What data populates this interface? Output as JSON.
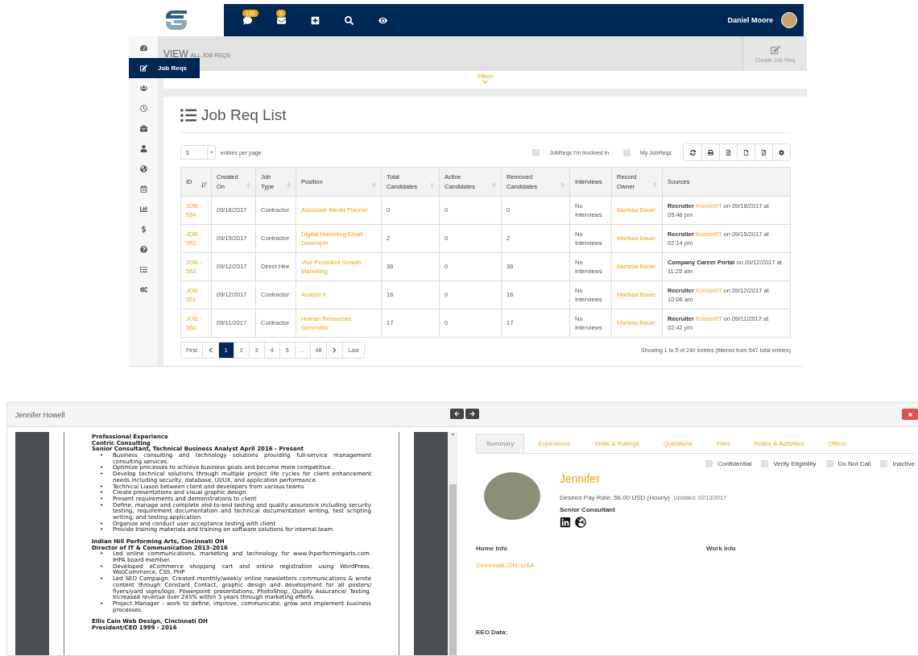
{
  "navbar": {
    "badges": [
      {
        "kind": "comments",
        "count": "131"
      },
      {
        "kind": "messages",
        "count": "8"
      },
      {
        "kind": "add"
      },
      {
        "kind": "search"
      },
      {
        "kind": "watch"
      }
    ],
    "user": "Daniel Moore"
  },
  "sidebar": {
    "items": [
      {
        "selected": false
      },
      {
        "selected": true,
        "label": "Job Reqs"
      },
      {
        "selected": false
      },
      {
        "selected": false
      },
      {
        "selected": false
      },
      {
        "selected": false
      },
      {
        "selected": false
      },
      {
        "selected": false
      },
      {
        "selected": false
      },
      {
        "selected": false
      },
      {
        "selected": false
      },
      {
        "selected": false
      },
      {
        "selected": false
      }
    ]
  },
  "header": {
    "title": "VIEW",
    "subtitle": "ALL JOB REQS",
    "action": "Create Job Req",
    "filters": "Filters"
  },
  "card": {
    "title": "Job Req List",
    "page_size": "5",
    "page_size_label": "entries per page",
    "checkboxes": [
      {
        "label": "JobReqs I'm involved in",
        "checked": false
      },
      {
        "label": "My JobReqs",
        "checked": false
      }
    ],
    "columns": [
      {
        "label": "ID",
        "sorted": true
      },
      {
        "label": "Created On",
        "sorted": false
      },
      {
        "label": "Job Type",
        "sorted": false
      },
      {
        "label": "Position",
        "sorted": false
      },
      {
        "label": "Total Candidates",
        "sorted": false
      },
      {
        "label": "Active Candidates",
        "sorted": false
      },
      {
        "label": "Removed Candidates",
        "sorted": false
      },
      {
        "label": "Interviews"
      },
      {
        "label": "Record Owner",
        "sorted": false
      },
      {
        "label": "Sources"
      }
    ],
    "rows": [
      {
        "id": "JOB - 554",
        "created": "09/18/2017",
        "type": "Contractor",
        "position": "Associate Media Planner",
        "total": "0",
        "active": "0",
        "removed": "0",
        "interviews": "No Interviews",
        "owner": "Marissa Bauer",
        "source": {
          "label": "Recruiter",
          "link": "KoncertIT",
          "rest": "on 09/18/2017 at 05:46 pm"
        }
      },
      {
        "id": "JOB - 553",
        "created": "09/15/2017",
        "type": "Contractor",
        "position": "Digital Marketing Email Developer",
        "total": "2",
        "active": "0",
        "removed": "2",
        "interviews": "No Interviews",
        "owner": "Marissa Bauer",
        "source": {
          "label": "Recruiter",
          "link": "KoncertIT",
          "rest": "on 09/15/2017 at 02:14 pm"
        }
      },
      {
        "id": "JOB - 552",
        "created": "09/12/2017",
        "type": "Direct Hire",
        "position": "Vice President Growth Marketing",
        "total": "36",
        "active": "0",
        "removed": "36",
        "interviews": "No Interviews",
        "owner": "Marissa Bauer",
        "source": {
          "label": "Company Career Portal",
          "rest": "on 09/12/2017 at 11:25 am"
        }
      },
      {
        "id": "JOB - 551",
        "created": "09/12/2017",
        "type": "Contractor",
        "position": "Analyst II",
        "total": "16",
        "active": "0",
        "removed": "16",
        "interviews": "No Interviews",
        "owner": "Marissa Bauer",
        "source": {
          "label": "Recruiter",
          "link": "KoncertIT",
          "rest": "on 09/12/2017 at 10:06 am"
        }
      },
      {
        "id": "JOB - 550",
        "created": "09/11/2017",
        "type": "Contractor",
        "position": "Human Resources Generalist",
        "total": "17",
        "active": "0",
        "removed": "17",
        "interviews": "No Interviews",
        "owner": "Marissa Bauer",
        "source": {
          "label": "Recruiter",
          "link": "KoncertIT",
          "rest": "on 09/11/2017 at 02:42 pm"
        }
      }
    ],
    "pagination": [
      {
        "kind": "text",
        "label": "First",
        "selected": false
      },
      {
        "kind": "prev",
        "selected": false
      },
      {
        "kind": "text",
        "label": "1",
        "selected": true
      },
      {
        "kind": "text",
        "label": "2",
        "selected": false
      },
      {
        "kind": "text",
        "label": "3",
        "selected": false
      },
      {
        "kind": "text",
        "label": "4",
        "selected": false
      },
      {
        "kind": "text",
        "label": "5",
        "selected": false
      },
      {
        "kind": "text",
        "label": "...",
        "selected": false
      },
      {
        "kind": "text",
        "label": "48",
        "selected": false
      },
      {
        "kind": "next",
        "selected": false
      },
      {
        "kind": "text",
        "label": "Last",
        "selected": false
      }
    ],
    "info": "Showing 1 to 5 of 240 entries (filtered from 547 total entries)"
  },
  "candidate": {
    "title": "Jennifer Howell",
    "resume": [
      {
        "marker": "•",
        "headings": [
          "Professional Experience",
          "Centric Consulting",
          "Senior Consultant, Technical Business Analyst April 2016 - Present"
        ],
        "bullets": [
          "Business consulting and technology solutions providing full-service management consulting services.",
          "Optimize processes to achieve business goals and become more competitive.",
          "Develop technical solutions through multiple project life cycles for client enhancement needs including security, database, UI/UX, and application performance.",
          "Technical Liason between client and developers from various teams",
          "Create presentations and visual graphic design",
          "Present requirements and demonstrations to client",
          "Define, manage and complete end-to-end testing and quality assurance including security testing, requirement documentation and technical documentation writing, test scripting writing, and testing application.",
          "Organize and conduct user acceptance testing with client",
          "Provide training materials and training on software solutions for internal team"
        ]
      },
      {
        "marker": "•",
        "headings": [
          "Indian Hill Performing Arts, Cincinnati OH",
          "Director of IT & Communication 2013-2016"
        ],
        "bullets": [
          "Led online communications, marketing and technology for www.ihperformingarts.com. IHPA board member.",
          "Developed eCommerce shopping cart and online registration using WordPress, WooCommerce, CSS, PHP",
          "Led SEO Campaign. Created monthly/weekly online newsletters communications & wrote content through Constant Contact, graphic design and development for all posters/ flyers/yard signs/logo, Powerpoint presentations, PhotoShop, Quality Assurance/ Testing. Increased revenue over 245% within 3 years through marketing efforts.",
          "Project Manager - work to define, improve, communicate, grow and implement business processes."
        ]
      },
      {
        "headings": [
          "Ellis Cain Web Design, Cincinnati OH",
          "President/CEO 1999 - 2016"
        ]
      }
    ],
    "tabs": [
      {
        "label": "Summary",
        "selected": true
      },
      {
        "label": "Experience",
        "selected": false
      },
      {
        "label": "Skills & Ratings",
        "selected": false
      },
      {
        "label": "Questions",
        "selected": false
      },
      {
        "label": "Files",
        "selected": false
      },
      {
        "label": "Notes & Activities",
        "selected": false
      },
      {
        "label": "Offers",
        "selected": false
      }
    ],
    "flags": [
      {
        "label": "Confidential",
        "checked": false
      },
      {
        "label": "Verify Eligibility",
        "checked": false
      },
      {
        "label": "Do Not Call",
        "checked": false
      },
      {
        "label": "Inactive",
        "checked": false
      }
    ],
    "name": "Jennifer",
    "pay_rate": "Desired Pay Rate: 56.00 USD (Hourly)",
    "updated": "Updated: 02/13/2017",
    "role": "Senior Consultant",
    "home_info": "Home Info",
    "location": "Cincinnati, OH, USA",
    "work_info": "Work Info",
    "eeo": "EEO Data:"
  }
}
